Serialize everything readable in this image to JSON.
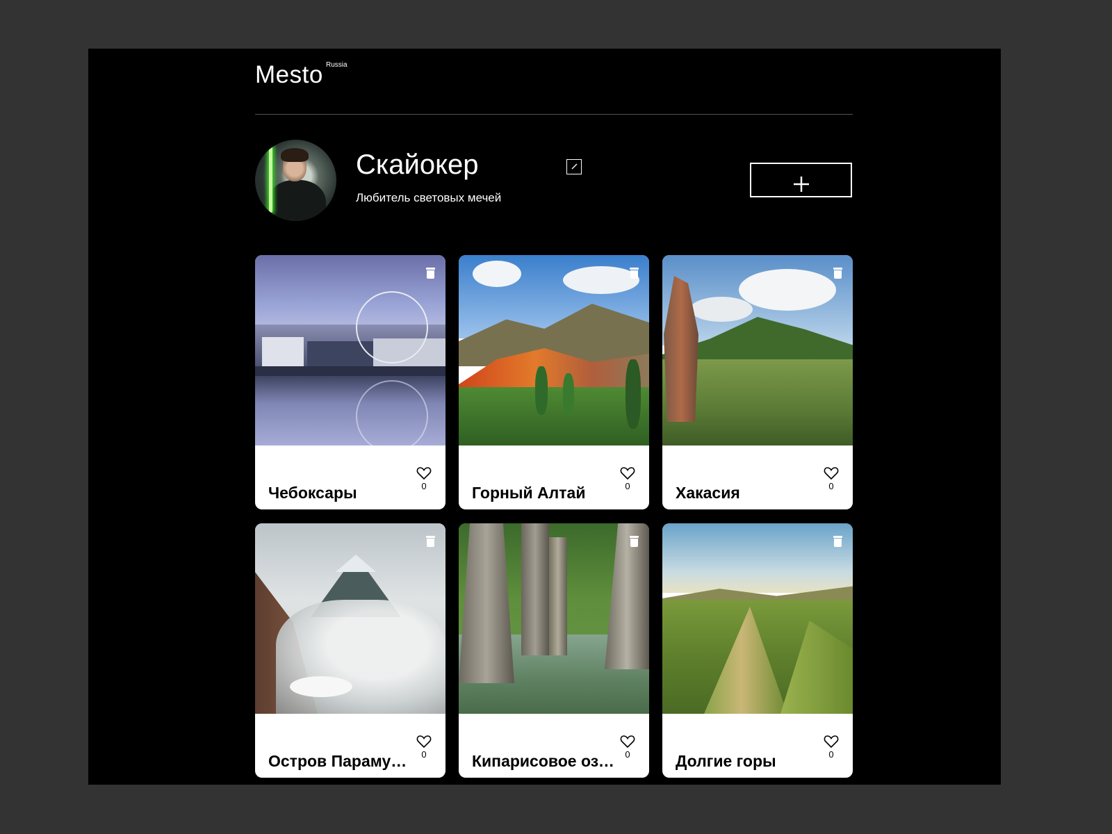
{
  "header": {
    "logo": "Mesto",
    "logo_sup": "Russia"
  },
  "profile": {
    "name": "Скайокер",
    "about": "Любитель световых мечей",
    "add_label": "+"
  },
  "cards": [
    {
      "title": "Чебоксары",
      "likes": "0"
    },
    {
      "title": "Горный Алтай",
      "likes": "0"
    },
    {
      "title": "Хакасия",
      "likes": "0"
    },
    {
      "title": "Остров Парамушир",
      "likes": "0"
    },
    {
      "title": "Кипарисовое озеро",
      "likes": "0"
    },
    {
      "title": "Долгие горы",
      "likes": "0"
    }
  ],
  "icons": [
    "edit-icon",
    "plus-icon",
    "trash-icon",
    "heart-icon"
  ],
  "colors": {
    "background": "#000000",
    "outer": "#333333",
    "card": "#ffffff",
    "text": "#ffffff"
  }
}
